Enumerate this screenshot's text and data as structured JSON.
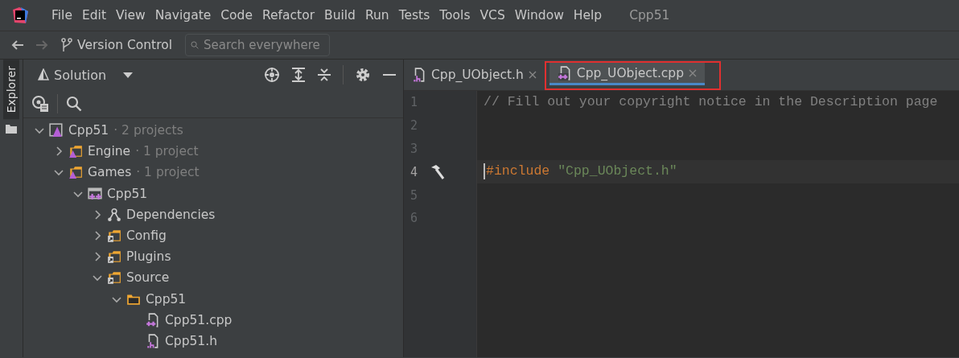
{
  "menu_bar": {
    "items": [
      "File",
      "Edit",
      "View",
      "Navigate",
      "Code",
      "Refactor",
      "Build",
      "Run",
      "Tests",
      "Tools",
      "VCS",
      "Window",
      "Help"
    ],
    "project_title": "Cpp51"
  },
  "toolbar": {
    "vcs_label": "Version Control",
    "search": {
      "placeholder": "Search everywhere"
    }
  },
  "side_strip": {
    "tabs": [
      {
        "label": "Explorer",
        "selected": true
      }
    ]
  },
  "explorer": {
    "view_selector": "Solution",
    "tree": [
      {
        "label": "Cpp51",
        "suffix": "· 2 projects",
        "kind": "solution",
        "expanded": true,
        "children": [
          {
            "label": "Engine",
            "suffix": "· 1 project",
            "kind": "project-folder",
            "expanded": false
          },
          {
            "label": "Games",
            "suffix": "· 1 project",
            "kind": "project-folder",
            "expanded": true,
            "children": [
              {
                "label": "Cpp51",
                "kind": "cpp-project",
                "expanded": true,
                "children": [
                  {
                    "label": "Dependencies",
                    "kind": "dependencies",
                    "expanded": false
                  },
                  {
                    "label": "Config",
                    "kind": "link-folder",
                    "expanded": false
                  },
                  {
                    "label": "Plugins",
                    "kind": "link-folder",
                    "expanded": false
                  },
                  {
                    "label": "Source",
                    "kind": "link-folder",
                    "expanded": true,
                    "children": [
                      {
                        "label": "Cpp51",
                        "kind": "folder",
                        "expanded": true,
                        "children": [
                          {
                            "label": "Cpp51.cpp",
                            "kind": "cpp-file"
                          },
                          {
                            "label": "Cpp51.h",
                            "kind": "h-file"
                          }
                        ]
                      }
                    ]
                  }
                ]
              }
            ]
          }
        ]
      }
    ]
  },
  "editor": {
    "tabs": [
      {
        "label": "Cpp_UObject.h",
        "kind": "h-file",
        "selected": false,
        "highlighted": false
      },
      {
        "label": "Cpp_UObject.cpp",
        "kind": "cpp-file",
        "selected": true,
        "highlighted": true
      }
    ],
    "lines": [
      {
        "number": "1",
        "current": false,
        "marker": false,
        "tokens": [
          {
            "kind": "comment",
            "text": "// Fill out your copyright notice in the Description page"
          }
        ]
      },
      {
        "number": "2",
        "current": false,
        "marker": false
      },
      {
        "number": "3",
        "current": false,
        "marker": false
      },
      {
        "number": "4",
        "current": true,
        "marker": true,
        "tokens": [
          {
            "kind": "directive",
            "text": "#include"
          },
          {
            "kind": "string",
            "text": "\"Cpp_UObject.h\""
          }
        ]
      },
      {
        "number": "5",
        "current": false,
        "marker": false
      },
      {
        "number": "6",
        "current": false,
        "marker": false
      }
    ]
  }
}
